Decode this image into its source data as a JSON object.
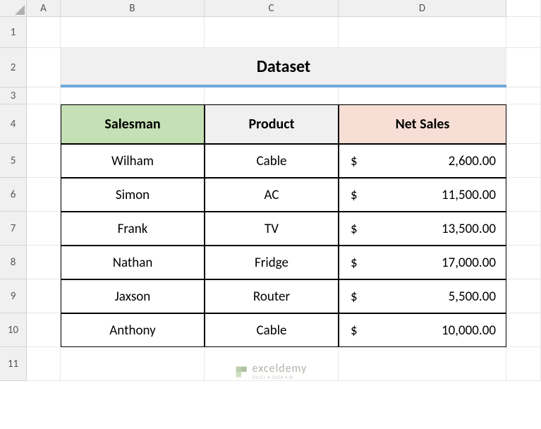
{
  "columns": [
    "A",
    "B",
    "C",
    "D"
  ],
  "rows": [
    "1",
    "2",
    "3",
    "4",
    "5",
    "6",
    "7",
    "8",
    "9",
    "10",
    "11"
  ],
  "title": "Dataset",
  "headers": {
    "salesman": "Salesman",
    "product": "Product",
    "netsales": "Net Sales"
  },
  "currency_symbol": "$",
  "data": [
    {
      "salesman": "Wilham",
      "product": "Cable",
      "netsales": "2,600.00"
    },
    {
      "salesman": "Simon",
      "product": "AC",
      "netsales": "11,500.00"
    },
    {
      "salesman": "Frank",
      "product": "TV",
      "netsales": "13,500.00"
    },
    {
      "salesman": "Nathan",
      "product": "Fridge",
      "netsales": "17,000.00"
    },
    {
      "salesman": "Jaxson",
      "product": "Router",
      "netsales": "5,500.00"
    },
    {
      "salesman": "Anthony",
      "product": "Cable",
      "netsales": "10,000.00"
    }
  ],
  "watermark": {
    "main": "exceldemy",
    "sub": "EXCEL • DATA • BI"
  },
  "chart_data": {
    "type": "table",
    "title": "Dataset",
    "columns": [
      "Salesman",
      "Product",
      "Net Sales"
    ],
    "rows": [
      [
        "Wilham",
        "Cable",
        2600.0
      ],
      [
        "Simon",
        "AC",
        11500.0
      ],
      [
        "Frank",
        "TV",
        13500.0
      ],
      [
        "Nathan",
        "Fridge",
        17000.0
      ],
      [
        "Jaxson",
        "Router",
        5500.0
      ],
      [
        "Anthony",
        "Cable",
        10000.0
      ]
    ]
  }
}
